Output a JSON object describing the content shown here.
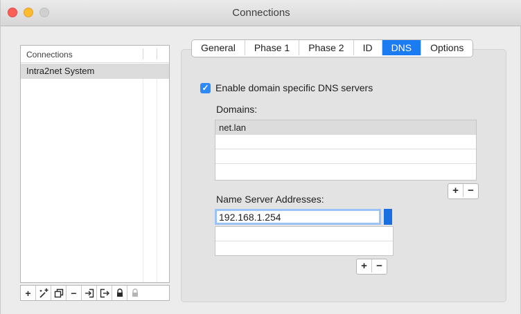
{
  "window": {
    "title": "Connections"
  },
  "sidebar": {
    "header": "Connections",
    "items": [
      {
        "label": "Intra2net System"
      }
    ],
    "toolbar_icons": [
      "plus-icon",
      "magic-wand-plus-icon",
      "duplicate-icon",
      "minus-icon",
      "import-icon",
      "export-icon",
      "lock-icon",
      "unlock-icon"
    ],
    "toolbar": {
      "plus": "+",
      "minus": "−"
    }
  },
  "tabs": [
    {
      "label": "General"
    },
    {
      "label": "Phase 1"
    },
    {
      "label": "Phase 2"
    },
    {
      "label": "ID"
    },
    {
      "label": "DNS",
      "active": true
    },
    {
      "label": "Options"
    }
  ],
  "dns": {
    "enable_label": "Enable domain specific DNS servers",
    "enable_checked": true,
    "check_glyph": "✓",
    "domains_label": "Domains:",
    "domains": [
      "net.lan"
    ],
    "name_servers_label": "Name Server Addresses:",
    "name_servers": [
      "192.168.1.254"
    ],
    "plus": "+",
    "minus": "−"
  },
  "colors": {
    "accent": "#1a7bf2",
    "close": "#fc5f57",
    "minimize": "#fdbc2e"
  }
}
